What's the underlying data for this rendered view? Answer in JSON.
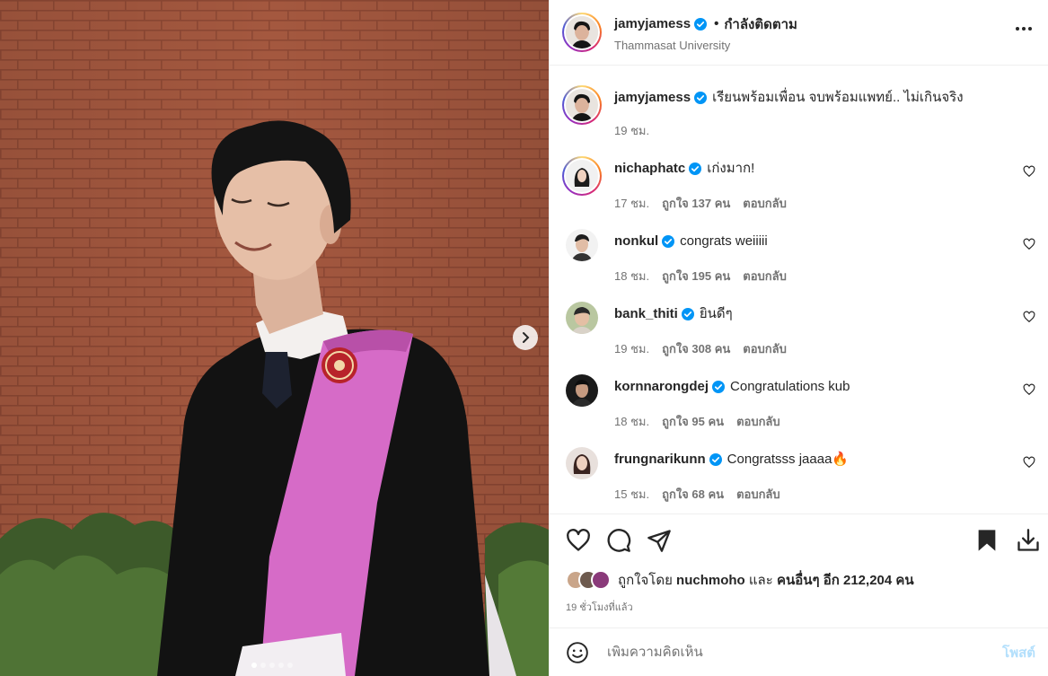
{
  "post": {
    "author": "jamyjamess",
    "follow_status": "กำลังติดตาม",
    "location": "Thammasat University",
    "caption": "เรียนพร้อมเพื่อน จบพร้อมแพทย์.. ไม่เกินจริง",
    "caption_time": "19 ชม."
  },
  "comments": [
    {
      "user": "nichaphatc",
      "text": "เก่งมาก!",
      "time": "17 ชม.",
      "likes": "ถูกใจ 137 คน",
      "reply": "ตอบกลับ"
    },
    {
      "user": "nonkul",
      "text": "congrats weiiiii",
      "time": "18 ชม.",
      "likes": "ถูกใจ 195 คน",
      "reply": "ตอบกลับ"
    },
    {
      "user": "bank_thiti",
      "text": "ยินดีๆ",
      "time": "19 ชม.",
      "likes": "ถูกใจ 308 คน",
      "reply": "ตอบกลับ"
    },
    {
      "user": "kornnarongdej",
      "text": "Congratulations kub",
      "time": "18 ชม.",
      "likes": "ถูกใจ 95 คน",
      "reply": "ตอบกลับ"
    },
    {
      "user": "frungnarikunn",
      "text": "Congratsss jaaaa🔥",
      "time": "15 ชม.",
      "likes": "ถูกใจ 68 คน",
      "reply": "ตอบกลับ"
    }
  ],
  "likes": {
    "prefix": "ถูกใจโดย",
    "first_liker": "nuchmoho",
    "and": "และ",
    "others": "คนอื่นๆ อีก 212,204 คน"
  },
  "post_time": "19 ชั่วโมงที่แล้ว",
  "add_comment": {
    "placeholder": "เพิ่มความคิดเห็น",
    "post_label": "โพสต์"
  },
  "carousel": {
    "current_index": 1,
    "total": 5
  },
  "colors": {
    "verified": "#0095f6",
    "post_disabled": "#b2dffc",
    "brick": "#a4583f",
    "sash": "#d66bc7"
  },
  "icons": [
    "verified-icon",
    "more-icon",
    "heart-icon",
    "comment-icon",
    "share-icon",
    "bookmark-icon",
    "download-icon",
    "emoji-icon",
    "chevron-right-icon"
  ]
}
